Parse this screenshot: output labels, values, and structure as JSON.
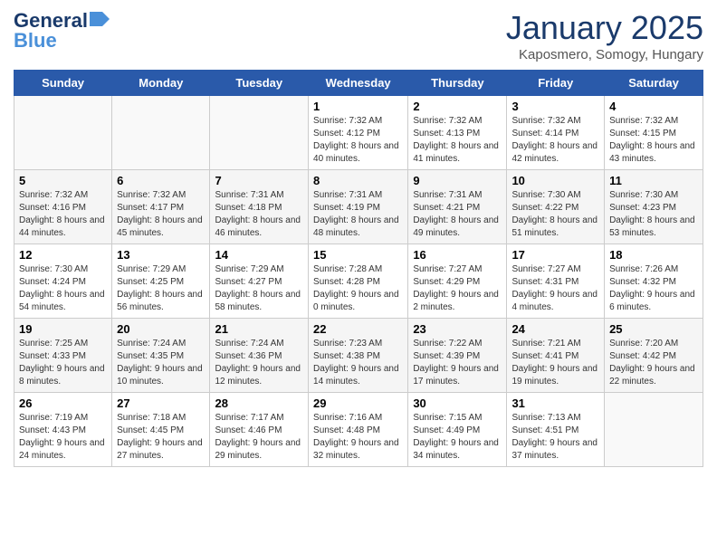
{
  "header": {
    "logo_line1": "General",
    "logo_line2": "Blue",
    "title": "January 2025",
    "subtitle": "Kaposmero, Somogy, Hungary"
  },
  "days_of_week": [
    "Sunday",
    "Monday",
    "Tuesday",
    "Wednesday",
    "Thursday",
    "Friday",
    "Saturday"
  ],
  "weeks": [
    [
      {
        "day": "",
        "text": ""
      },
      {
        "day": "",
        "text": ""
      },
      {
        "day": "",
        "text": ""
      },
      {
        "day": "1",
        "text": "Sunrise: 7:32 AM\nSunset: 4:12 PM\nDaylight: 8 hours and 40 minutes."
      },
      {
        "day": "2",
        "text": "Sunrise: 7:32 AM\nSunset: 4:13 PM\nDaylight: 8 hours and 41 minutes."
      },
      {
        "day": "3",
        "text": "Sunrise: 7:32 AM\nSunset: 4:14 PM\nDaylight: 8 hours and 42 minutes."
      },
      {
        "day": "4",
        "text": "Sunrise: 7:32 AM\nSunset: 4:15 PM\nDaylight: 8 hours and 43 minutes."
      }
    ],
    [
      {
        "day": "5",
        "text": "Sunrise: 7:32 AM\nSunset: 4:16 PM\nDaylight: 8 hours and 44 minutes."
      },
      {
        "day": "6",
        "text": "Sunrise: 7:32 AM\nSunset: 4:17 PM\nDaylight: 8 hours and 45 minutes."
      },
      {
        "day": "7",
        "text": "Sunrise: 7:31 AM\nSunset: 4:18 PM\nDaylight: 8 hours and 46 minutes."
      },
      {
        "day": "8",
        "text": "Sunrise: 7:31 AM\nSunset: 4:19 PM\nDaylight: 8 hours and 48 minutes."
      },
      {
        "day": "9",
        "text": "Sunrise: 7:31 AM\nSunset: 4:21 PM\nDaylight: 8 hours and 49 minutes."
      },
      {
        "day": "10",
        "text": "Sunrise: 7:30 AM\nSunset: 4:22 PM\nDaylight: 8 hours and 51 minutes."
      },
      {
        "day": "11",
        "text": "Sunrise: 7:30 AM\nSunset: 4:23 PM\nDaylight: 8 hours and 53 minutes."
      }
    ],
    [
      {
        "day": "12",
        "text": "Sunrise: 7:30 AM\nSunset: 4:24 PM\nDaylight: 8 hours and 54 minutes."
      },
      {
        "day": "13",
        "text": "Sunrise: 7:29 AM\nSunset: 4:25 PM\nDaylight: 8 hours and 56 minutes."
      },
      {
        "day": "14",
        "text": "Sunrise: 7:29 AM\nSunset: 4:27 PM\nDaylight: 8 hours and 58 minutes."
      },
      {
        "day": "15",
        "text": "Sunrise: 7:28 AM\nSunset: 4:28 PM\nDaylight: 9 hours and 0 minutes."
      },
      {
        "day": "16",
        "text": "Sunrise: 7:27 AM\nSunset: 4:29 PM\nDaylight: 9 hours and 2 minutes."
      },
      {
        "day": "17",
        "text": "Sunrise: 7:27 AM\nSunset: 4:31 PM\nDaylight: 9 hours and 4 minutes."
      },
      {
        "day": "18",
        "text": "Sunrise: 7:26 AM\nSunset: 4:32 PM\nDaylight: 9 hours and 6 minutes."
      }
    ],
    [
      {
        "day": "19",
        "text": "Sunrise: 7:25 AM\nSunset: 4:33 PM\nDaylight: 9 hours and 8 minutes."
      },
      {
        "day": "20",
        "text": "Sunrise: 7:24 AM\nSunset: 4:35 PM\nDaylight: 9 hours and 10 minutes."
      },
      {
        "day": "21",
        "text": "Sunrise: 7:24 AM\nSunset: 4:36 PM\nDaylight: 9 hours and 12 minutes."
      },
      {
        "day": "22",
        "text": "Sunrise: 7:23 AM\nSunset: 4:38 PM\nDaylight: 9 hours and 14 minutes."
      },
      {
        "day": "23",
        "text": "Sunrise: 7:22 AM\nSunset: 4:39 PM\nDaylight: 9 hours and 17 minutes."
      },
      {
        "day": "24",
        "text": "Sunrise: 7:21 AM\nSunset: 4:41 PM\nDaylight: 9 hours and 19 minutes."
      },
      {
        "day": "25",
        "text": "Sunrise: 7:20 AM\nSunset: 4:42 PM\nDaylight: 9 hours and 22 minutes."
      }
    ],
    [
      {
        "day": "26",
        "text": "Sunrise: 7:19 AM\nSunset: 4:43 PM\nDaylight: 9 hours and 24 minutes."
      },
      {
        "day": "27",
        "text": "Sunrise: 7:18 AM\nSunset: 4:45 PM\nDaylight: 9 hours and 27 minutes."
      },
      {
        "day": "28",
        "text": "Sunrise: 7:17 AM\nSunset: 4:46 PM\nDaylight: 9 hours and 29 minutes."
      },
      {
        "day": "29",
        "text": "Sunrise: 7:16 AM\nSunset: 4:48 PM\nDaylight: 9 hours and 32 minutes."
      },
      {
        "day": "30",
        "text": "Sunrise: 7:15 AM\nSunset: 4:49 PM\nDaylight: 9 hours and 34 minutes."
      },
      {
        "day": "31",
        "text": "Sunrise: 7:13 AM\nSunset: 4:51 PM\nDaylight: 9 hours and 37 minutes."
      },
      {
        "day": "",
        "text": ""
      }
    ]
  ]
}
